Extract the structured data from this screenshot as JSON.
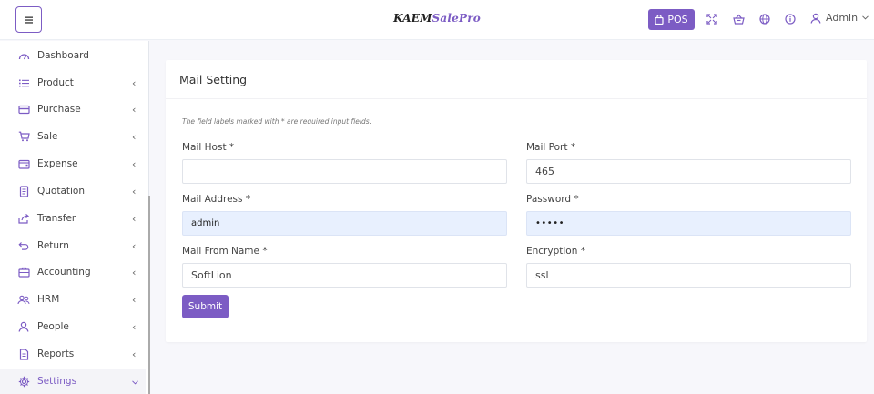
{
  "header": {
    "brand_part1": "KAEM",
    "brand_part2": "SalePro",
    "pos_label": "POS",
    "admin_label": "Admin"
  },
  "icons": {
    "menu": "menu-icon",
    "pos": "shopping-bag-icon",
    "fullscreen": "expand-icon",
    "basket": "basket-icon",
    "language": "globe-icon",
    "help": "info-icon",
    "user": "user-icon"
  },
  "sidebar": {
    "items": [
      {
        "label": "Dashboard",
        "icon": "speedometer-icon"
      },
      {
        "label": "Product",
        "icon": "list-icon"
      },
      {
        "label": "Purchase",
        "icon": "card-icon"
      },
      {
        "label": "Sale",
        "icon": "cart-icon"
      },
      {
        "label": "Expense",
        "icon": "wallet-icon"
      },
      {
        "label": "Quotation",
        "icon": "document-icon"
      },
      {
        "label": "Transfer",
        "icon": "share-icon"
      },
      {
        "label": "Return",
        "icon": "return-icon"
      },
      {
        "label": "Accounting",
        "icon": "briefcase-icon"
      },
      {
        "label": "HRM",
        "icon": "users-icon"
      },
      {
        "label": "People",
        "icon": "person-icon"
      },
      {
        "label": "Reports",
        "icon": "report-icon"
      },
      {
        "label": "Settings",
        "icon": "gear-icon"
      }
    ]
  },
  "form": {
    "title": "Mail Setting",
    "note": "The field labels marked with * are required input fields.",
    "mail_host_label": "Mail Host *",
    "mail_host_value": "",
    "mail_port_label": "Mail Port *",
    "mail_port_value": "465",
    "mail_address_label": "Mail Address *",
    "mail_address_value": "admin",
    "password_label": "Password *",
    "password_value": "•••••",
    "mail_from_name_label": "Mail From Name *",
    "mail_from_name_value": "SoftLion",
    "encryption_label": "Encryption *",
    "encryption_value": "ssl",
    "submit_label": "Submit"
  },
  "colors": {
    "accent": "#7c5cc4",
    "autofill": "#e8f0fe"
  }
}
